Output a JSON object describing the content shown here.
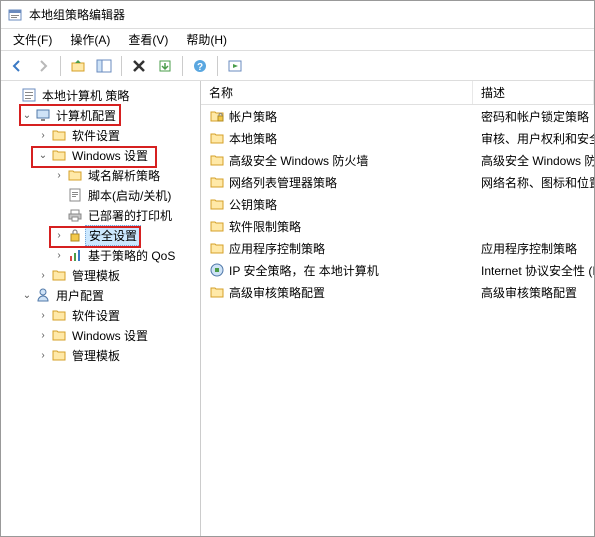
{
  "window": {
    "title": "本地组策略编辑器"
  },
  "menu": {
    "file": "文件(F)",
    "action": "操作(A)",
    "view": "查看(V)",
    "help": "帮助(H)"
  },
  "toolbar_icons": {
    "back": "back-icon",
    "forward": "forward-icon",
    "up": "up-icon",
    "show_hide": "show-hide-icon",
    "delete": "delete-icon",
    "export": "export-icon",
    "help": "help-icon",
    "run": "run-icon"
  },
  "tree": {
    "root": "本地计算机 策略",
    "computer_config": "计算机配置",
    "computer_children": {
      "software_settings": "软件设置",
      "windows_settings": "Windows 设置",
      "windows_children": {
        "name_resolution": "域名解析策略",
        "scripts": "脚本(启动/关机)",
        "printers": "已部署的打印机",
        "security_settings": "安全设置",
        "qos": "基于策略的 QoS"
      },
      "admin_templates": "管理模板"
    },
    "user_config": "用户配置",
    "user_children": {
      "software_settings": "软件设置",
      "windows_settings": "Windows 设置",
      "admin_templates": "管理模板"
    }
  },
  "list": {
    "col_name": "名称",
    "col_desc": "描述",
    "rows": [
      {
        "name": "帐户策略",
        "desc": "密码和帐户锁定策略",
        "icon": "folder-lock-icon"
      },
      {
        "name": "本地策略",
        "desc": "审核、用户权利和安全选项",
        "icon": "folder-icon"
      },
      {
        "name": "高级安全 Windows 防火墙",
        "desc": "高级安全 Windows 防火墙",
        "icon": "folder-icon"
      },
      {
        "name": "网络列表管理器策略",
        "desc": "网络名称、图标和位置组策略",
        "icon": "folder-icon"
      },
      {
        "name": "公钥策略",
        "desc": "",
        "icon": "folder-icon"
      },
      {
        "name": "软件限制策略",
        "desc": "",
        "icon": "folder-icon"
      },
      {
        "name": "应用程序控制策略",
        "desc": "应用程序控制策略",
        "icon": "folder-icon"
      },
      {
        "name": "IP 安全策略，在 本地计算机",
        "desc": "Internet 协议安全性 (IPsec)",
        "icon": "ipsec-icon"
      },
      {
        "name": "高级审核策略配置",
        "desc": "高级审核策略配置",
        "icon": "folder-icon"
      }
    ]
  }
}
